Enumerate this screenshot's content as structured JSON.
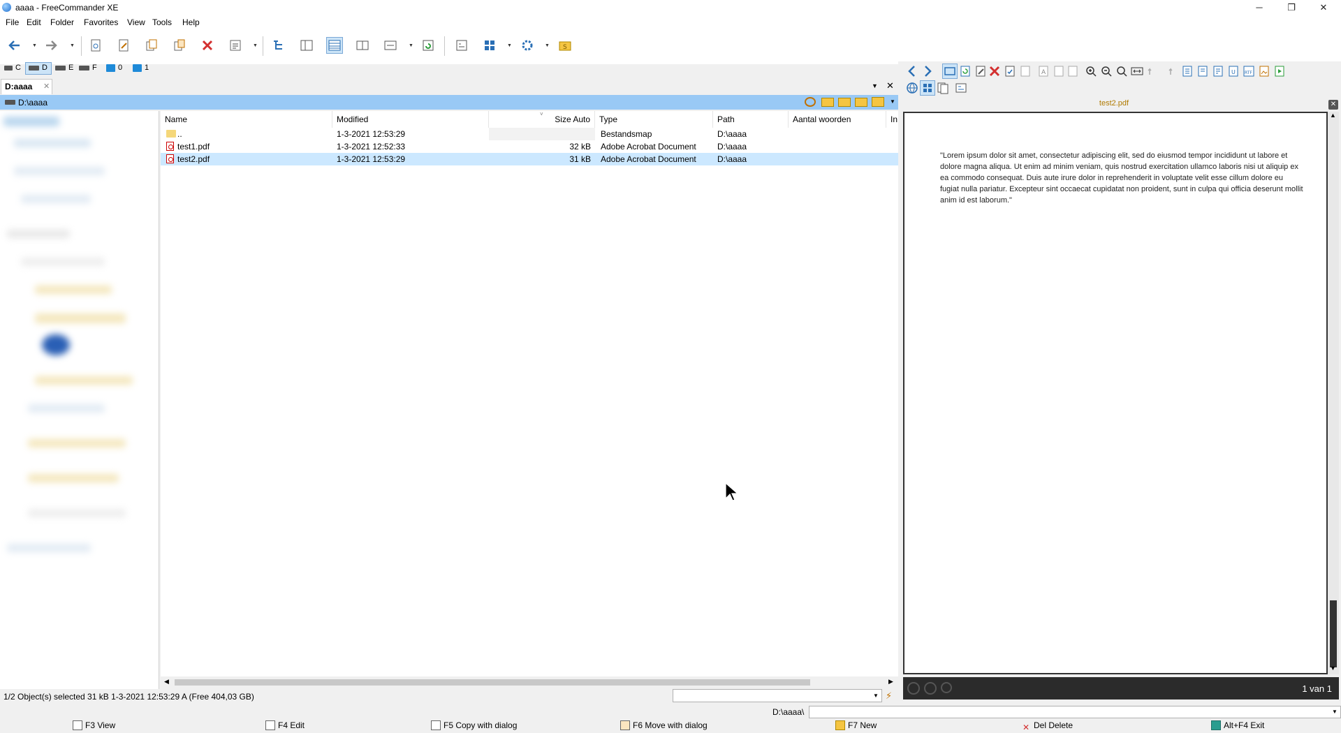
{
  "window": {
    "title": "aaaa - FreeCommander XE",
    "minimize": "─",
    "maximize": "❐",
    "close": "✕"
  },
  "menu": [
    "File",
    "Edit",
    "Folder",
    "Favorites",
    "View",
    "Tools",
    "Help"
  ],
  "drives": [
    {
      "letter": "C"
    },
    {
      "letter": "D"
    },
    {
      "letter": "E"
    },
    {
      "letter": "F"
    },
    {
      "letter": "0"
    },
    {
      "letter": "1"
    }
  ],
  "tab": {
    "label": "D:aaaa",
    "close": "✕"
  },
  "path": "D:\\aaaa",
  "columns": [
    "Name",
    "Modified",
    "Size Auto",
    "Type",
    "Path",
    "Aantal woorden",
    "In"
  ],
  "files": [
    {
      "name": "..",
      "modified": "1-3-2021 12:53:29",
      "size": "",
      "type": "Bestandsmap",
      "path": "D:\\aaaa",
      "kind": "folder"
    },
    {
      "name": "test1.pdf",
      "modified": "1-3-2021 12:52:33",
      "size": "32 kB",
      "type": "Adobe Acrobat Document",
      "path": "D:\\aaaa",
      "kind": "pdf"
    },
    {
      "name": "test2.pdf",
      "modified": "1-3-2021 12:53:29",
      "size": "31 kB",
      "type": "Adobe Acrobat Document",
      "path": "D:\\aaaa",
      "kind": "pdf",
      "selected": true
    }
  ],
  "status": "1/2 Object(s) selected   31 kB   1-3-2021 12:53:29   A   (Free 404,03 GB)",
  "cmdline": {
    "path": "D:\\aaaa\\"
  },
  "fkeys": [
    "F3 View",
    "F4 Edit",
    "F5 Copy with dialog",
    "F6 Move with dialog",
    "F7 New",
    "Del Delete",
    "Alt+F4 Exit"
  ],
  "preview": {
    "filename": "test2.pdf",
    "text": "\"Lorem ipsum dolor sit amet, consectetur adipiscing elit, sed do eiusmod tempor incididunt ut labore et dolore magna aliqua. Ut enim ad minim veniam, quis nostrud exercitation ullamco laboris nisi ut aliquip ex ea commodo consequat. Duis aute irure dolor in reprehenderit in voluptate velit esse cillum dolore eu fugiat nulla pariatur. Excepteur sint occaecat cupidatat non proident, sunt in culpa qui officia deserunt mollit anim id est laborum.\"",
    "page_indicator": "1 van 1"
  },
  "colors": {
    "path_bar": "#99c9f5",
    "selection": "#cce8ff",
    "accent_red": "#d32f2f",
    "preview_title": "#b07a00"
  }
}
